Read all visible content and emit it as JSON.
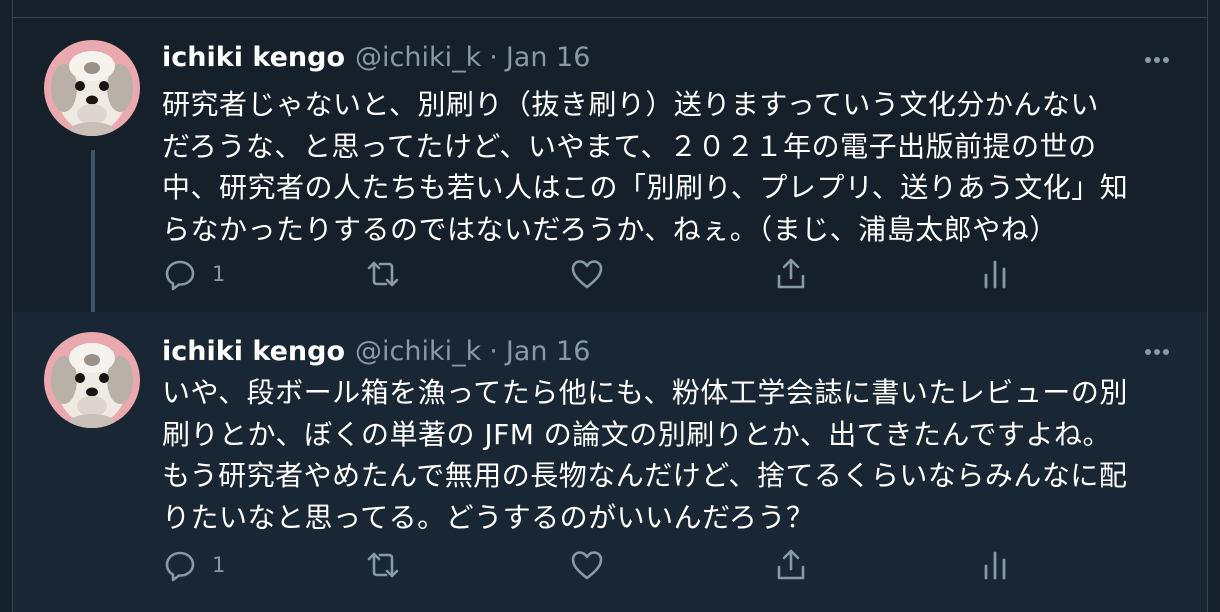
{
  "colors": {
    "background": "#15202b",
    "highlighted_background": "#192734",
    "text_primary": "#ffffff",
    "text_secondary": "#8899a6",
    "border": "#38444d"
  },
  "tweets": [
    {
      "author": {
        "name": "ichiki kengo",
        "handle": "@ichiki_k",
        "avatar_icon": "dog-avatar"
      },
      "separator": "·",
      "date": "Jan 16",
      "text_lines": [
        "研究者じゃないと、別刷り（抜き刷り）送りますっていう文化分かんない",
        "だろうな、と思ってたけど、いやまて、２０２１年の電子出版前提の世の",
        "中、研究者の人たちも若い人はこの「別刷り、プレプリ、送りあう文化」知",
        "らなかったりするのではないだろうか、ねぇ。（まじ、浦島太郎やね）"
      ],
      "actions": {
        "reply_icon": "reply-icon",
        "reply_count": "1",
        "retweet_icon": "retweet-icon",
        "like_icon": "heart-icon",
        "share_icon": "share-icon",
        "analytics_icon": "analytics-icon"
      }
    },
    {
      "author": {
        "name": "ichiki kengo",
        "handle": "@ichiki_k",
        "avatar_icon": "dog-avatar"
      },
      "separator": "·",
      "date": "Jan 16",
      "text_lines": [
        "いや、段ボール箱を漁ってたら他にも、粉体工学会誌に書いたレビューの別",
        "刷りとか、ぼくの単著の JFM の論文の別刷りとか、出てきたんですよね。",
        "もう研究者やめたんで無用の長物なんだけど、捨てるくらいならみんなに配",
        "りたいなと思ってる。どうするのがいいんだろう？"
      ],
      "actions": {
        "reply_icon": "reply-icon",
        "reply_count": "1",
        "retweet_icon": "retweet-icon",
        "like_icon": "heart-icon",
        "share_icon": "share-icon",
        "analytics_icon": "analytics-icon"
      }
    }
  ]
}
